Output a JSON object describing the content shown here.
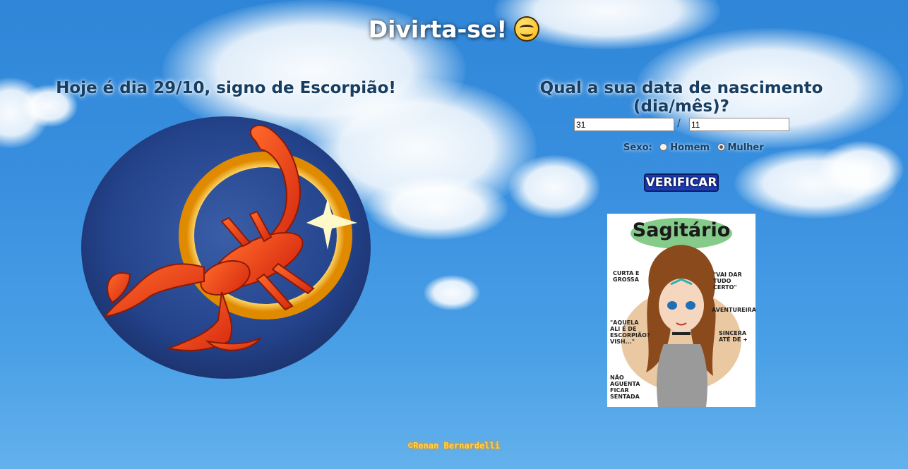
{
  "header": {
    "title": "Divirta-se!",
    "emoji_icon": "smiling-face-icon"
  },
  "today": {
    "heading": "Hoje é dia 29/10, signo de Escorpião!",
    "image_icon": "scorpio-zodiac-illustration"
  },
  "form": {
    "question": "Qual a sua data de nascimento (dia/mês)?",
    "day_value": "31",
    "separator": "/",
    "month_value": "11",
    "sex_label": "Sexo:",
    "option_male": "Homem",
    "option_female": "Mulher",
    "selected_option": "Mulher",
    "verify_label": "VERIFICAR"
  },
  "result": {
    "title": "Sagitário",
    "notes": [
      "Curta e grossa",
      "\"Vai dar tudo certo\"",
      "Aventureira",
      "Sincera até de +",
      "\"Aquela ali é de escorpião? Vish...\"",
      "Não aguenta ficar sentada"
    ]
  },
  "footer": {
    "credit": "©Renan Bernardelli"
  },
  "colors": {
    "sky": "#3a90df",
    "heading": "#163e63",
    "button": "#1d3bb3",
    "footer": "#ffd84a"
  }
}
